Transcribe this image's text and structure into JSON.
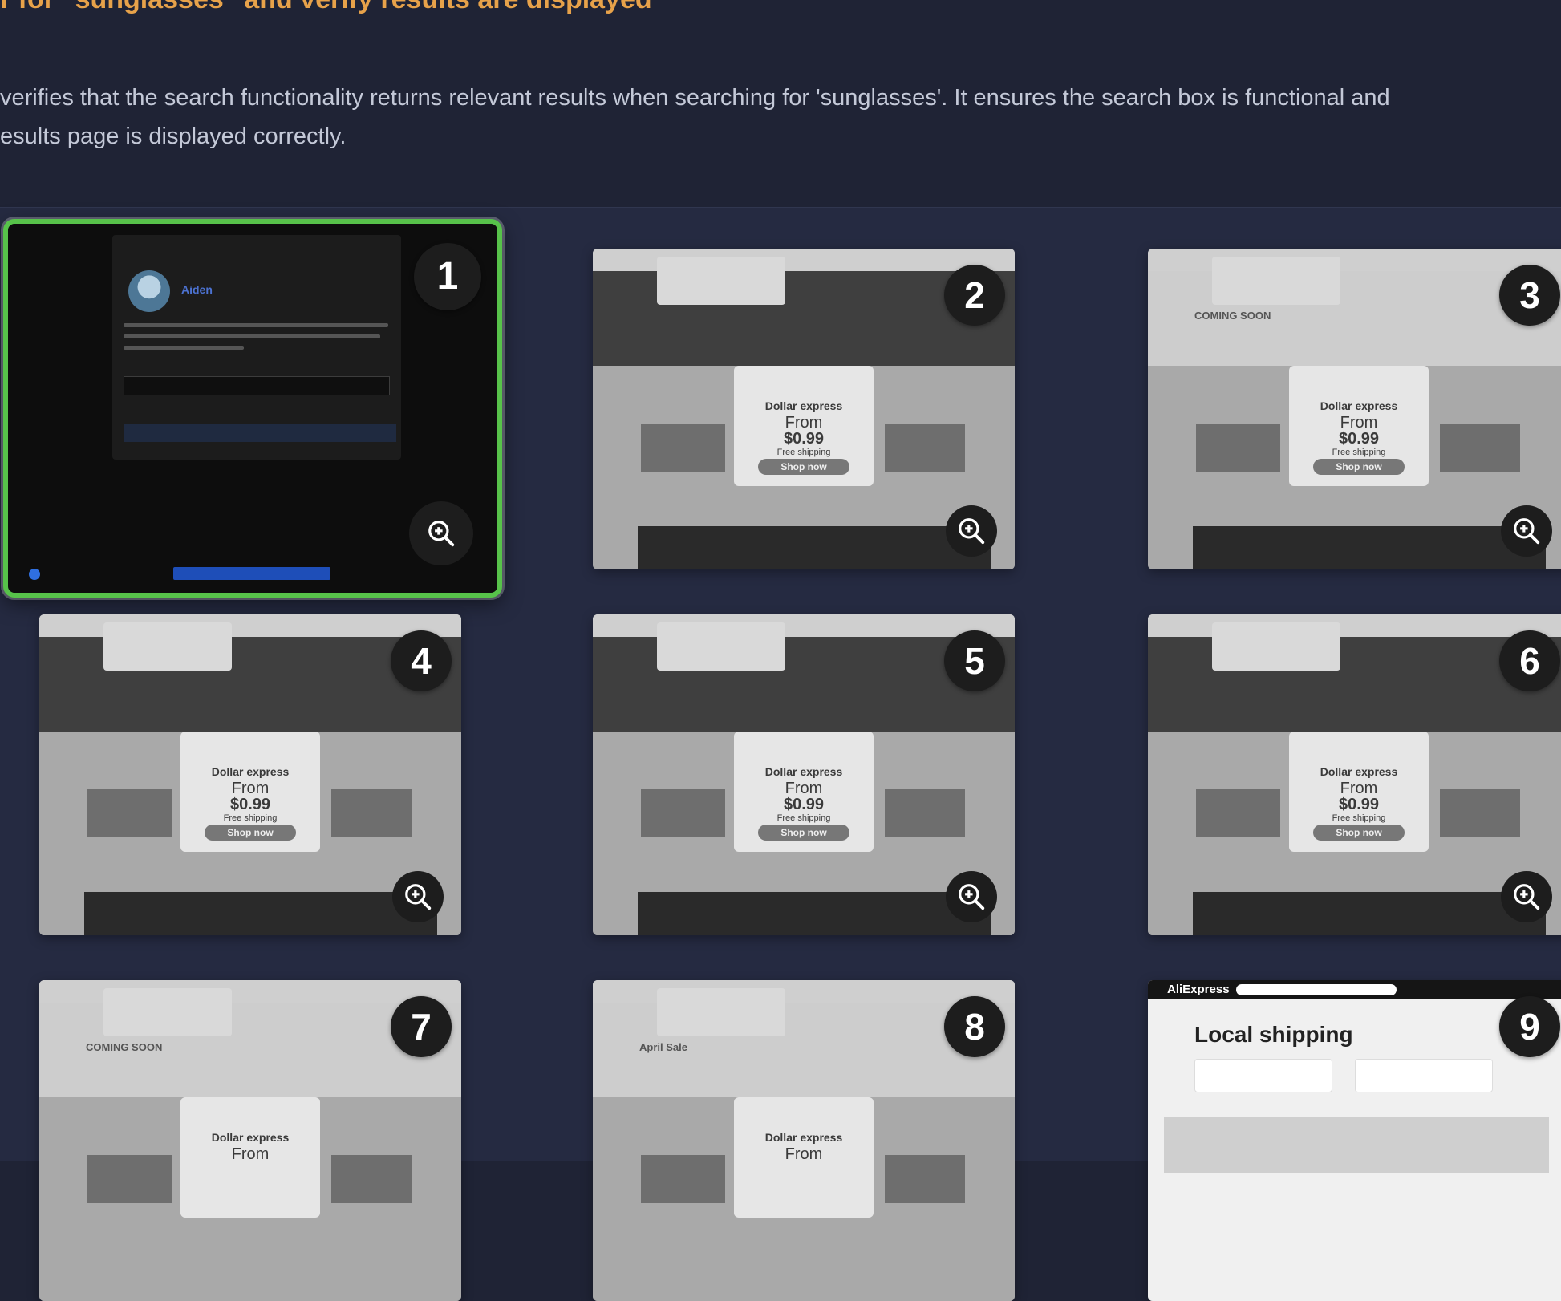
{
  "test": {
    "title": "r for \"sunglasses\" and verify results are displayed",
    "description_line1": "verifies that the search functionality returns relevant results when searching for 'sunglasses'. It ensures the search box is functional and",
    "description_line2": "esults page is displayed correctly."
  },
  "step1": {
    "agent_name": "Aiden"
  },
  "screens": {
    "dollar_express": "Dollar express",
    "from": "From",
    "price": "$0.99",
    "free_shipping": "Free shipping",
    "shop_now": "Shop now",
    "coming_soon": "COMING SOON",
    "april_sale": "April Sale",
    "logo": "AliExpress",
    "local_shipping": "Local shipping"
  },
  "steps": [
    {
      "number": "1",
      "active": true
    },
    {
      "number": "2",
      "active": false
    },
    {
      "number": "3",
      "active": false
    },
    {
      "number": "4",
      "active": false
    },
    {
      "number": "5",
      "active": false
    },
    {
      "number": "6",
      "active": false
    },
    {
      "number": "7",
      "active": false
    },
    {
      "number": "8",
      "active": false
    },
    {
      "number": "9",
      "active": false
    }
  ],
  "colors": {
    "background": "#1f2335",
    "title": "#e7a24a",
    "active_border": "#57c24a"
  },
  "icons": {
    "zoom": "zoom-in-icon"
  }
}
